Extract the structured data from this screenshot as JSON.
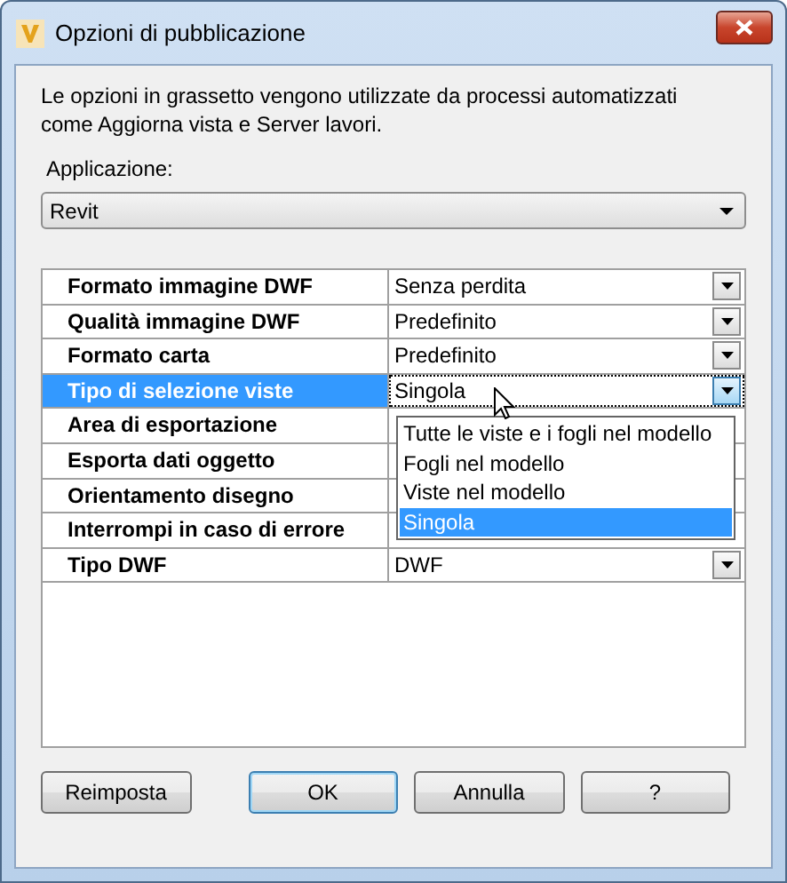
{
  "window": {
    "title": "Opzioni di pubblicazione"
  },
  "description": "Le opzioni in grassetto vengono utilizzate da processi automatizzati come Aggiorna vista e Server lavori.",
  "application": {
    "label": "Applicazione:",
    "value": "Revit"
  },
  "properties": [
    {
      "name": "Formato immagine DWF",
      "value": "Senza perdita",
      "selected": false
    },
    {
      "name": "Qualità immagine DWF",
      "value": "Predefinito",
      "selected": false
    },
    {
      "name": "Formato carta",
      "value": "Predefinito",
      "selected": false
    },
    {
      "name": "Tipo di selezione viste",
      "value": "Singola",
      "selected": true
    },
    {
      "name": "Area di esportazione",
      "selected": false
    },
    {
      "name": "Esporta dati oggetto",
      "selected": false
    },
    {
      "name": "Orientamento disegno",
      "selected": false
    },
    {
      "name": "Interrompi in caso di errore",
      "selected": false
    },
    {
      "name": "Tipo DWF",
      "value": "DWF",
      "selected": false
    }
  ],
  "dropdown": {
    "items": [
      {
        "label": "Tutte le viste e i fogli nel modello",
        "selected": false
      },
      {
        "label": "Fogli nel modello",
        "selected": false
      },
      {
        "label": "Viste nel modello",
        "selected": false
      },
      {
        "label": "Singola",
        "selected": true
      }
    ]
  },
  "buttons": [
    {
      "label": "Reimposta",
      "default": false
    },
    {
      "label": "OK",
      "default": true
    },
    {
      "label": "Annulla",
      "default": false
    },
    {
      "label": "?",
      "default": false
    }
  ]
}
